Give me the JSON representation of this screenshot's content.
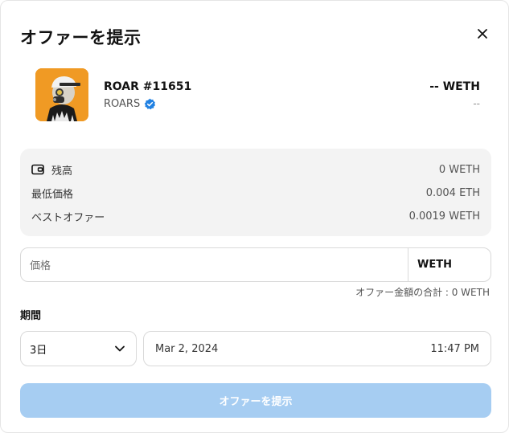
{
  "modal": {
    "title": "オファーを提示",
    "close_icon": "close-icon"
  },
  "item": {
    "name": "ROAR #11651",
    "collection": "ROARS",
    "verified_icon": "verified-badge-icon",
    "price": "-- WETH",
    "price_fiat": "--"
  },
  "info": {
    "balance_label": "残高",
    "balance_value": "0 WETH",
    "floor_label": "最低価格",
    "floor_value": "0.004 ETH",
    "best_offer_label": "ベストオファー",
    "best_offer_value": "0.0019 WETH",
    "wallet_icon": "wallet-icon"
  },
  "price_input": {
    "placeholder": "価格",
    "currency": "WETH"
  },
  "total": "オファー金額の合計 : 0 WETH",
  "duration": {
    "label": "期間",
    "selected": "3日",
    "date": "Mar 2, 2024",
    "time": "11:47 PM"
  },
  "submit_label": "オファーを提示",
  "colors": {
    "accent_disabled": "#a6cdf2",
    "thumb_bg": "#f09a24",
    "verified": "#2081e2"
  }
}
